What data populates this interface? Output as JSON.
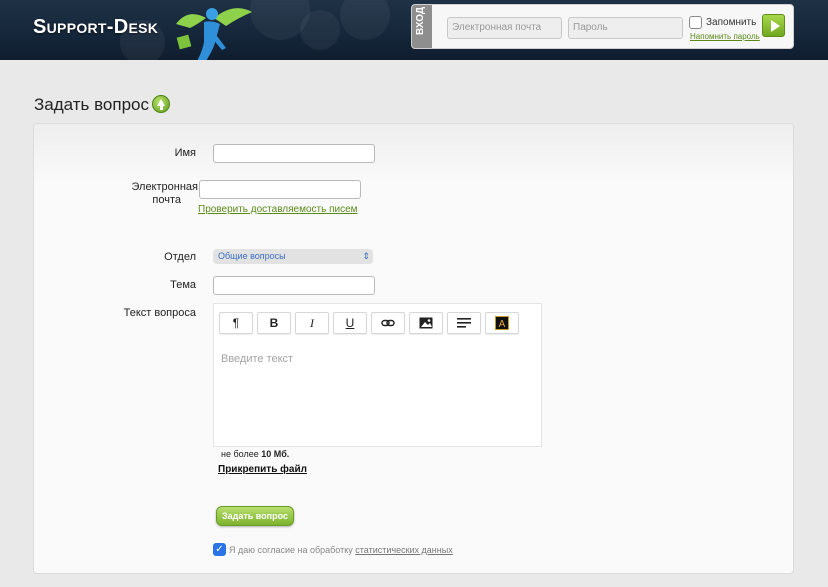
{
  "header": {
    "logo_text": "Support-Desk",
    "login": {
      "tab_label": "ВХОД",
      "email_placeholder": "Электронная почта",
      "password_placeholder": "Пароль",
      "remember_label": "Запомнить",
      "forgot_link": "Напомнить пароль"
    }
  },
  "page": {
    "title": "Задать вопрос"
  },
  "form": {
    "name_label": "Имя",
    "email_label_line1": "Электронная",
    "email_label_line2": "почта",
    "verify_link": "Проверить доставляемость писем",
    "department_label": "Отдел",
    "department_value": "Общие вопросы",
    "subject_label": "Тема",
    "question_label": "Текст вопроса",
    "editor_placeholder": "Введите текст",
    "toolbar": {
      "paragraph": "¶",
      "bold": "B",
      "italic": "I",
      "underline": "U"
    },
    "size_hint_prefix": "не более ",
    "size_hint_value": "10 Мб.",
    "attach_link": "Прикрепить файл",
    "submit_label": "Задать вопрос",
    "consent_text": "Я даю согласие на обработку ",
    "consent_link": "статистических данных",
    "consent_checked": true
  },
  "colors": {
    "accent_green": "#7db22d",
    "link_green": "#5b8a1a",
    "header_navy": "#15263a",
    "checkbox_blue": "#2b74e8"
  }
}
